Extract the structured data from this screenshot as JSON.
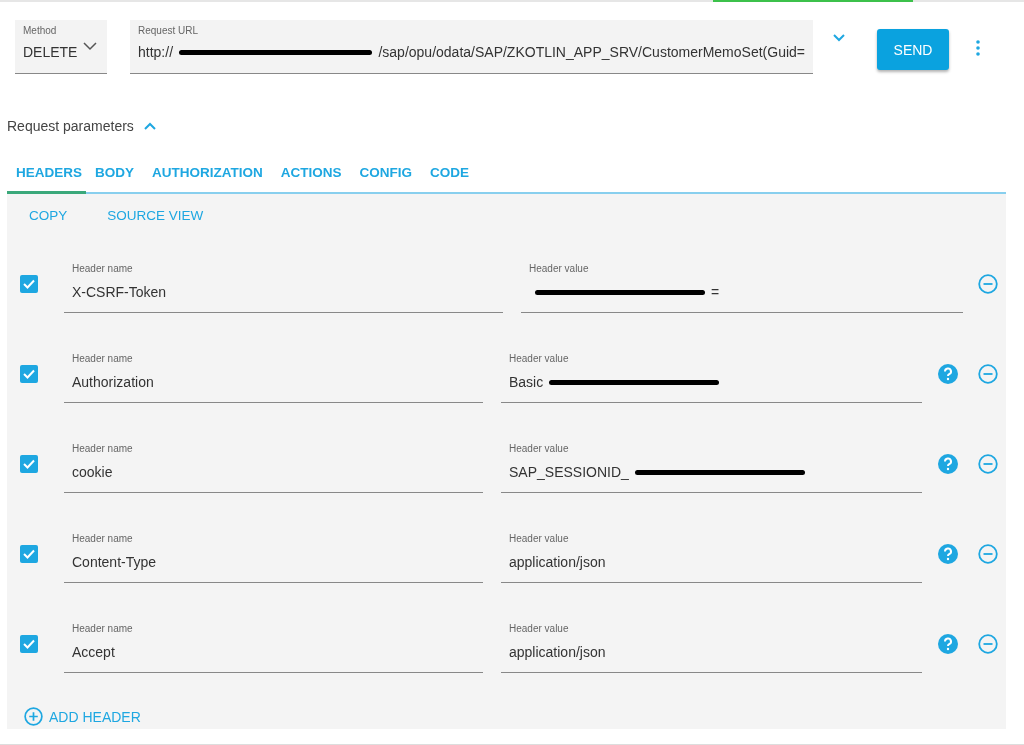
{
  "method": {
    "label": "Method",
    "value": "DELETE"
  },
  "url": {
    "label": "Request URL",
    "before": "http://",
    "redacted": true,
    "after": "/sap/opu/odata/SAP/ZKOTLIN_APP_SRV/CustomerMemoSet(Guid="
  },
  "send_button": "SEND",
  "request_parameters": {
    "label": "Request parameters",
    "expanded": true
  },
  "tabs": [
    {
      "label": "HEADERS",
      "selected": true
    },
    {
      "label": "BODY",
      "selected": false
    },
    {
      "label": "AUTHORIZATION",
      "selected": false
    },
    {
      "label": "ACTIONS",
      "selected": false
    },
    {
      "label": "CONFIG",
      "selected": false
    },
    {
      "label": "CODE",
      "selected": false
    }
  ],
  "actions": [
    "COPY",
    "SOURCE VIEW"
  ],
  "headers": [
    {
      "checked": true,
      "name_label": "Header name",
      "name": "X-CSRF-Token",
      "value_label": "Header value",
      "redacted": true,
      "after": "=",
      "help": false
    },
    {
      "checked": true,
      "name_label": "Header name",
      "name": "Authorization",
      "value_label": "Header value",
      "before": "Basic ",
      "redacted": true,
      "help": true
    },
    {
      "checked": true,
      "name_label": "Header name",
      "name": "cookie",
      "value_label": "Header value",
      "before": "SAP_SESSIONID_",
      "redacted": true,
      "help": true
    },
    {
      "checked": true,
      "name_label": "Header name",
      "name": "Content-Type",
      "value_label": "Header value",
      "before": "application/json",
      "help": true
    },
    {
      "checked": true,
      "name_label": "Header name",
      "name": "Accept",
      "value_label": "Header value",
      "before": "application/json",
      "help": true
    }
  ],
  "add_header": "ADD HEADER"
}
